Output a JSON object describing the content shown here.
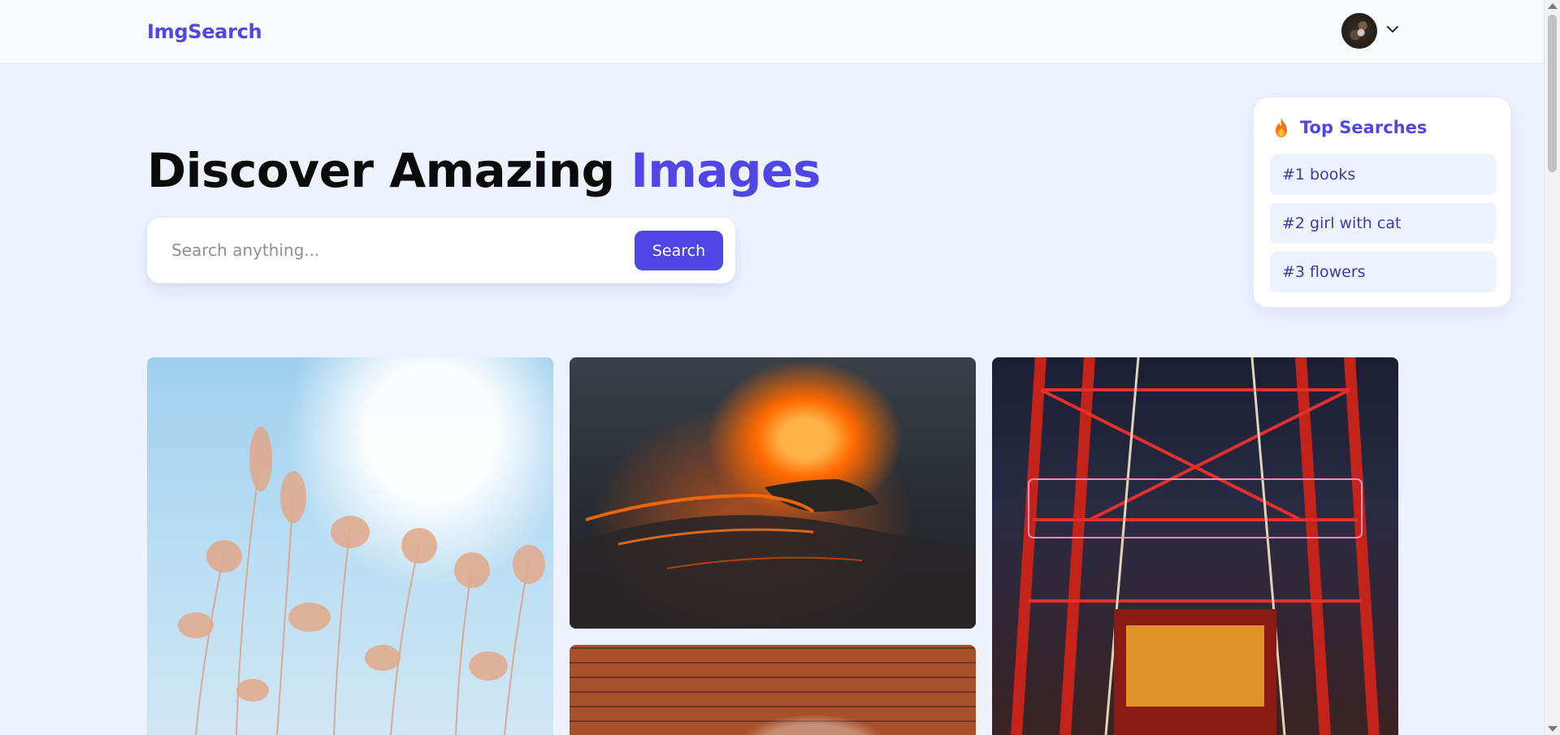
{
  "header": {
    "logo": "ImgSearch",
    "avatar_icon": "user-avatar",
    "menu_icon": "chevron-down-icon"
  },
  "hero": {
    "title_main": "Discover Amazing ",
    "title_accent": "Images"
  },
  "search": {
    "placeholder": "Search anything...",
    "value": "",
    "button_label": "Search"
  },
  "top_searches": {
    "icon": "flame-icon",
    "title": "Top Searches",
    "items": [
      {
        "label": "#1 books"
      },
      {
        "label": "#2 girl with cat"
      },
      {
        "label": "#3 flowers"
      }
    ]
  },
  "gallery": {
    "images": [
      {
        "subject": "pampas-grass-sky"
      },
      {
        "subject": "volcano-lava"
      },
      {
        "subject": "boomerang-ride"
      },
      {
        "subject": "brick-wall"
      }
    ]
  },
  "colors": {
    "accent": "#4f46e5",
    "page_bg": "#eef2ff",
    "chip_bg": "#eef2ff",
    "chip_text": "#3f3aa8"
  }
}
